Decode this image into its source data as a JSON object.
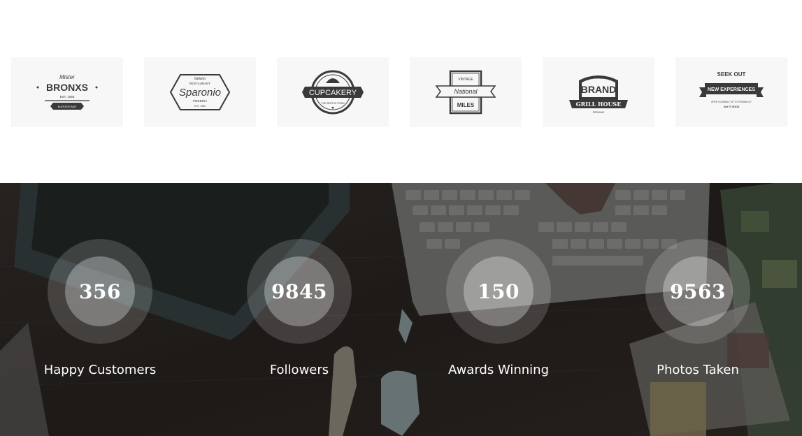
{
  "clients": {
    "logos": [
      {
        "name": "Mister Bronxs",
        "lines": [
          "Mister",
          "BRONXS",
          "EST. 1956",
          "BURGER BAR"
        ]
      },
      {
        "name": "Sparonio",
        "lines": [
          "Italiano",
          "RESTAURANT",
          "Sparonio",
          "PIZZERIA",
          "EST. 1984"
        ]
      },
      {
        "name": "Cupcakery",
        "lines": [
          "CUPCAKERY",
          "THE BEST IN TOWN"
        ]
      },
      {
        "name": "Vintage National Miles",
        "lines": [
          "VINTAGE",
          "National",
          "MILES"
        ]
      },
      {
        "name": "Premium Brand Grill House",
        "lines": [
          "Premium",
          "BRAND",
          "GRILL HOUSE",
          "PREMIUM"
        ]
      },
      {
        "name": "Seek Out New Experiences",
        "lines": [
          "SEEK OUT",
          "NEW EXPERIENCES",
          "OPEN YOURSELF UP TO POSSIBILITY",
          "SAY IT GOOD"
        ]
      }
    ]
  },
  "stats": {
    "items": [
      {
        "value": "356",
        "label": "Happy Customers"
      },
      {
        "value": "9845",
        "label": "Followers"
      },
      {
        "value": "150",
        "label": "Awards Winning"
      },
      {
        "value": "9563",
        "label": "Photos Taken"
      }
    ]
  }
}
